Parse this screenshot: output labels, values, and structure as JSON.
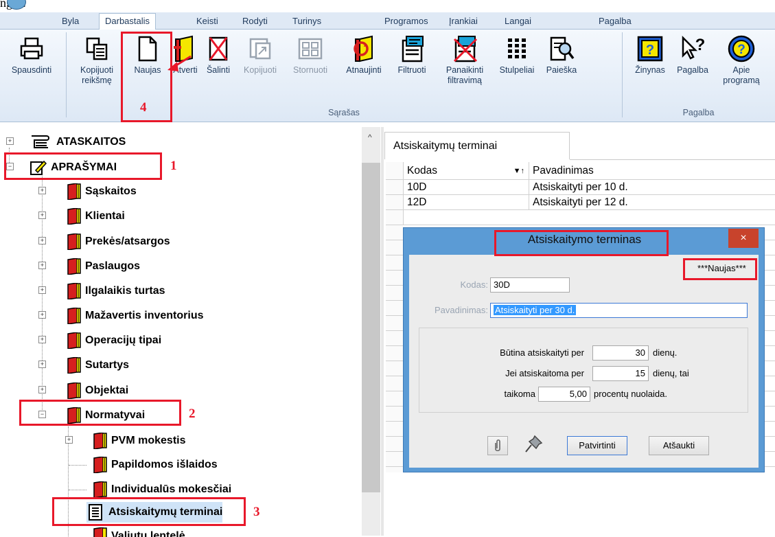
{
  "top_crop_text": "ngas:",
  "menu": {
    "tabs": [
      "Byla",
      "Darbastalis",
      "Keisti",
      "Rodyti",
      "Turinys",
      "Programos",
      "Įrankiai",
      "Langai",
      "Pagalba"
    ],
    "active": "Darbastalis"
  },
  "ribbon": {
    "buttons": [
      {
        "label": "Spausdinti",
        "icon": "printer-icon"
      },
      {
        "label": "Kopijuoti reikšmę",
        "icon": "copy-value-icon"
      },
      {
        "label": "Naujas",
        "icon": "new-document-icon"
      },
      {
        "label": "Atverti",
        "icon": "open-book-icon"
      },
      {
        "label": "Šalinti",
        "icon": "delete-icon"
      },
      {
        "label": "Kopijuoti",
        "icon": "copy-icon",
        "disabled": true
      },
      {
        "label": "Stornuoti",
        "icon": "storno-icon",
        "disabled": true
      },
      {
        "label": "Atnaujinti",
        "icon": "refresh-icon"
      },
      {
        "label": "Filtruoti",
        "icon": "filter-icon"
      },
      {
        "label": "Panaikinti filtravimą",
        "icon": "clear-filter-icon"
      },
      {
        "label": "Stulpeliai",
        "icon": "columns-icon"
      },
      {
        "label": "Paieška",
        "icon": "search-icon"
      },
      {
        "label": "Žinynas",
        "icon": "help-book-icon"
      },
      {
        "label": "Pagalba",
        "icon": "help-pointer-icon"
      },
      {
        "label": "Apie programą",
        "icon": "about-icon"
      }
    ],
    "groups": {
      "list": "Sąrašas",
      "help": "Pagalba"
    }
  },
  "tree": {
    "items": [
      "ATASKAITOS",
      "APRAŠYMAI",
      "Sąskaitos",
      "Klientai",
      "Prekės/atsargos",
      "Paslaugos",
      "Ilgalaikis turtas",
      "Mažavertis inventorius",
      "Operacijų tipai",
      "Sutartys",
      "Objektai",
      "Normatyvai",
      "PVM mokestis",
      "Papildomos išlaidos",
      "Individualūs mokesčiai",
      "Atsiskaitymų terminai",
      "Valiutų lentelė"
    ]
  },
  "grid": {
    "tab": "Atsiskaitymų terminai",
    "columns": [
      "Kodas",
      "Pavadinimas"
    ],
    "sort_glyph": "▼↑",
    "rows": [
      [
        "10D",
        "Atsiskaityti per 10 d."
      ],
      [
        "12D",
        "Atsiskaityti per 12 d."
      ]
    ]
  },
  "dialog": {
    "title": "Atsiskaitymo terminas",
    "close": "×",
    "badge": "***Naujas***",
    "code_label": "Kodas:",
    "code_value": "30D",
    "name_label": "Pavadinimas:",
    "name_value": "Atsiskaityti per 30 d.",
    "must_pay_label": "Būtina atsiskaityti per",
    "must_pay_value": "30",
    "must_pay_unit": "dienų.",
    "if_paid_label": "Jei atsiskaitoma per",
    "if_paid_value": "15",
    "if_paid_unit": "dienų, tai",
    "applied_label": "taikoma",
    "discount_value": "5,00",
    "discount_unit": "procentų nuolaida.",
    "confirm": "Patvirtinti",
    "cancel": "Atšaukti"
  },
  "annotations": [
    "1",
    "2",
    "3",
    "4"
  ],
  "colors": {
    "annotation_red": "#e8182a",
    "dialog_blue": "#5b9bd5",
    "close_red": "#c8432c"
  }
}
